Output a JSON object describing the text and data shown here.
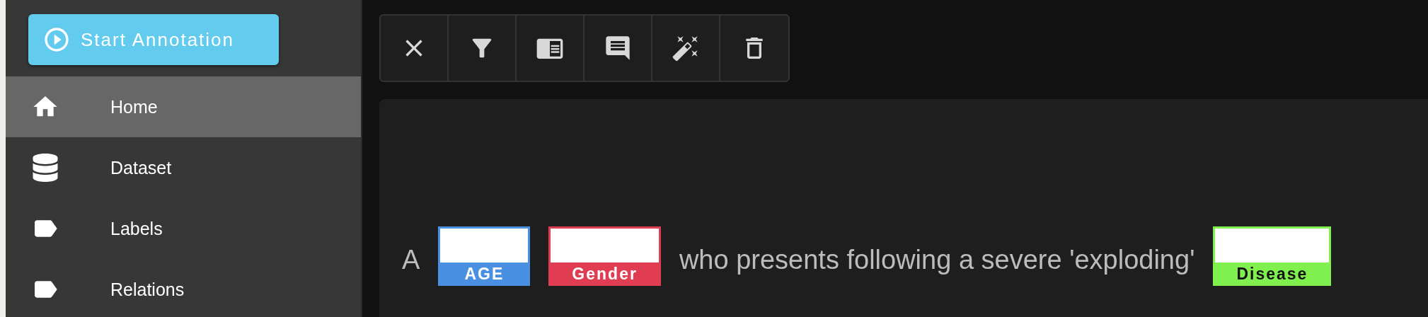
{
  "start_button": {
    "label": "Start Annotation"
  },
  "sidebar": {
    "items": [
      {
        "label": "Home",
        "selected": true
      },
      {
        "label": "Dataset",
        "selected": false
      },
      {
        "label": "Labels",
        "selected": false
      },
      {
        "label": "Relations",
        "selected": false
      }
    ]
  },
  "document": {
    "segments": [
      {
        "kind": "text",
        "text": "A"
      },
      {
        "kind": "entity",
        "label": "AGE",
        "color": "#4a90e2"
      },
      {
        "kind": "entity",
        "label": "Gender",
        "color": "#e03c52"
      },
      {
        "kind": "text",
        "text": "who presents following a severe 'exploding'"
      },
      {
        "kind": "entity",
        "label": "Disease",
        "color": "#80f04f"
      }
    ]
  }
}
